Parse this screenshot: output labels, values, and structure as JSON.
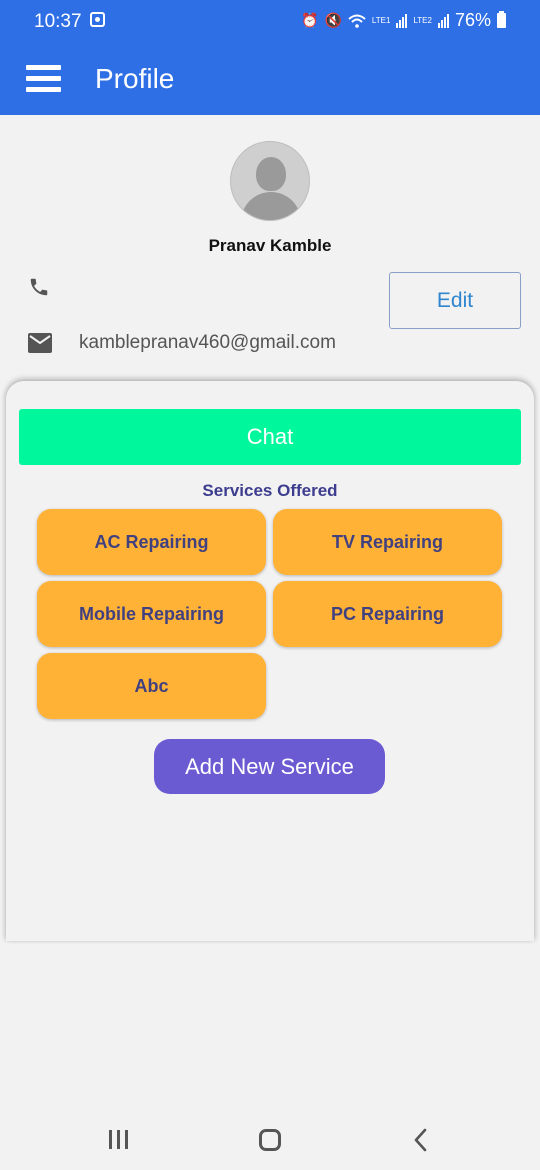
{
  "status_bar": {
    "time": "10:37",
    "lte1": "LTE1",
    "lte2": "LTE2",
    "battery": "76%"
  },
  "app_bar": {
    "title": "Profile"
  },
  "profile": {
    "name": "Pranav Kamble",
    "email": "kamblepranav460@gmail.com",
    "edit_label": "Edit"
  },
  "chat_label": "Chat",
  "services": {
    "title": "Services Offered",
    "items": [
      "AC Repairing",
      "TV Repairing",
      "Mobile Repairing",
      "PC Repairing",
      "Abc"
    ]
  },
  "add_service_label": "Add New Service",
  "colors": {
    "app_bar": "#2f6fe6",
    "chat_button": "#00f79c",
    "service_chip": "#ffb236",
    "service_text": "#414180",
    "add_button": "#6b5bd2",
    "edit_text": "#2f86cf"
  },
  "icons": [
    "menu-icon",
    "phone-icon",
    "mail-icon",
    "nav-recent-apps-icon",
    "nav-home-icon",
    "nav-back-icon"
  ]
}
